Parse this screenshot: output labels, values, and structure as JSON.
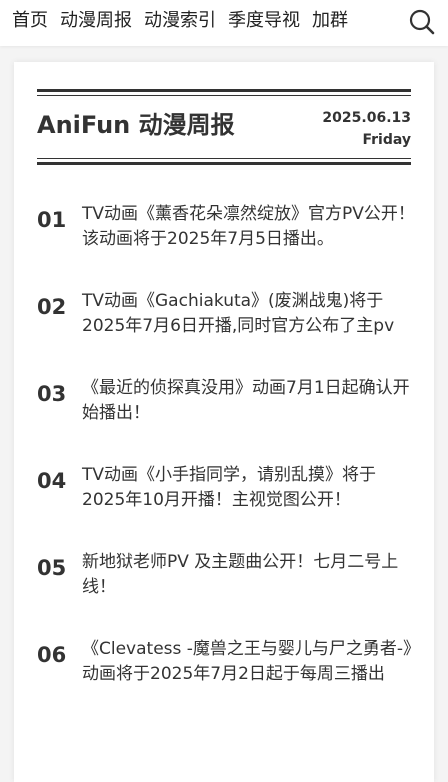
{
  "nav": {
    "items": [
      "首页",
      "动漫周报",
      "动漫索引",
      "季度导视",
      "加群"
    ],
    "search_icon": "search-icon"
  },
  "masthead": {
    "brand": "AniFun 动漫周报",
    "date": "2025.06.13",
    "weekday": "Friday"
  },
  "news": [
    {
      "num": "01",
      "title": "TV动画《薰香花朵凛然绽放》官方PV公开！该动画将于2025年7月5日播出。"
    },
    {
      "num": "02",
      "title": "TV动画《Gachiakuta》(废渊战鬼)将于2025年7月6日开播,同时官方公布了主pv"
    },
    {
      "num": "03",
      "title": "《最近的侦探真没用》动画7月1日起确认开始播出！"
    },
    {
      "num": "04",
      "title": "TV动画《小手指同学，请别乱摸》将于2025年10月开播！主视觉图公开！"
    },
    {
      "num": "05",
      "title": "新地狱老师PV 及主题曲公开！七月二号上线！"
    },
    {
      "num": "06",
      "title": "《Clevatess -魔兽之王与婴儿与尸之勇者-》动画将于2025年7月2日起于每周三播出"
    }
  ],
  "colors": {
    "text": "#333333",
    "background": "#f4f4f4",
    "card": "#ffffff"
  }
}
